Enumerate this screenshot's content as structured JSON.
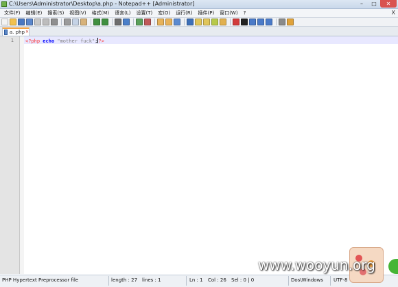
{
  "window": {
    "title": "C:\\Users\\Administrator\\Desktop\\a.php - Notepad++ [Administrator]",
    "icon": "notepad-plus-plus-icon",
    "minimize_glyph": "–",
    "maximize_glyph": "□",
    "close_glyph": "✕"
  },
  "menu": {
    "items": [
      "文件(F)",
      "编辑(E)",
      "搜索(S)",
      "视图(V)",
      "格式(M)",
      "语言(L)",
      "设置(T)",
      "宏(O)",
      "运行(R)",
      "插件(P)",
      "窗口(W)",
      "?"
    ],
    "close_label": "X"
  },
  "toolbar": {
    "buttons": [
      {
        "name": "new-file-icon",
        "color": "#f3f3f3"
      },
      {
        "name": "open-file-icon",
        "color": "#f2c14e"
      },
      {
        "name": "save-icon",
        "color": "#4a78c2"
      },
      {
        "name": "save-all-icon",
        "color": "#5b87cc"
      },
      {
        "name": "close-file-icon",
        "color": "#c9c9c9"
      },
      {
        "name": "close-all-icon",
        "color": "#bdbdbd"
      },
      {
        "name": "print-icon",
        "color": "#8f8f8f"
      },
      {
        "name": "sep"
      },
      {
        "name": "cut-icon",
        "color": "#9b9b9b"
      },
      {
        "name": "copy-icon",
        "color": "#c5d3e6"
      },
      {
        "name": "paste-icon",
        "color": "#d7b27a"
      },
      {
        "name": "sep"
      },
      {
        "name": "undo-icon",
        "color": "#3f8f3f"
      },
      {
        "name": "redo-icon",
        "color": "#3f8f3f"
      },
      {
        "name": "sep"
      },
      {
        "name": "find-icon",
        "color": "#6d6d6d"
      },
      {
        "name": "replace-icon",
        "color": "#4b7fc9"
      },
      {
        "name": "sep"
      },
      {
        "name": "zoom-in-icon",
        "color": "#5aa05a"
      },
      {
        "name": "zoom-out-icon",
        "color": "#c05a5a"
      },
      {
        "name": "sep"
      },
      {
        "name": "sync-vertical-icon",
        "color": "#e7b25a"
      },
      {
        "name": "sync-horizontal-icon",
        "color": "#e7b25a"
      },
      {
        "name": "word-wrap-icon",
        "color": "#5b8ad0"
      },
      {
        "name": "sep"
      },
      {
        "name": "show-all-chars-icon",
        "color": "#3d6fb8"
      },
      {
        "name": "indent-guide-icon",
        "color": "#e0c55a"
      },
      {
        "name": "lang-icon",
        "color": "#e0c55a"
      },
      {
        "name": "doc-map-icon",
        "color": "#b7c94a"
      },
      {
        "name": "function-list-icon",
        "color": "#e1b04f"
      },
      {
        "name": "sep"
      },
      {
        "name": "record-macro-icon",
        "color": "#d23b3b"
      },
      {
        "name": "stop-record-icon",
        "color": "#222222"
      },
      {
        "name": "play-macro-icon",
        "color": "#4a7ac8"
      },
      {
        "name": "run-macro-multiple-icon",
        "color": "#4a7ac8"
      },
      {
        "name": "save-macro-icon",
        "color": "#4a7ac8"
      },
      {
        "name": "sep"
      },
      {
        "name": "spell-check-icon",
        "color": "#8a8a8a"
      },
      {
        "name": "plugin-icon",
        "color": "#e0a23a"
      }
    ]
  },
  "tabs": [
    {
      "label": "a. php",
      "close_glyph": "✕",
      "icon": "saved-file-icon"
    }
  ],
  "editor": {
    "line_numbers": [
      "1"
    ],
    "code_tokens": [
      {
        "text": "<?php",
        "kind": "tag"
      },
      {
        "text": " ",
        "kind": "punc"
      },
      {
        "text": "echo",
        "kind": "kw"
      },
      {
        "text": " ",
        "kind": "punc"
      },
      {
        "text": "\"mother fuck\"",
        "kind": "str"
      },
      {
        "text": ";",
        "kind": "punc"
      },
      {
        "text": "?>",
        "kind": "tag"
      }
    ],
    "caret_after_token": 5,
    "current_line_color": "#e8e8ff"
  },
  "status": {
    "file_type": "PHP Hypertext Preprocessor file",
    "length": "length : 27",
    "lines": "lines : 1",
    "ln": "Ln : 1",
    "col": "Col : 26",
    "sel": "Sel : 0 | 0",
    "eol": "Dos\\Windows",
    "encoding": "UTF-8"
  },
  "watermark": {
    "text": "www.wooyun.org"
  }
}
